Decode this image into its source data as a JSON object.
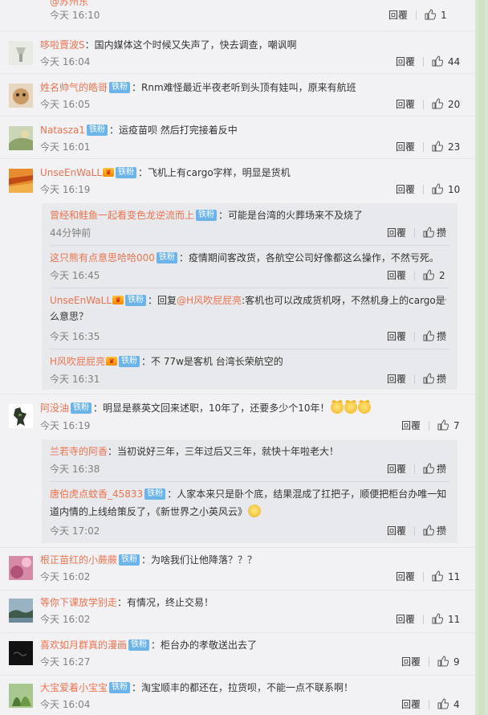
{
  "reply_label": "回覆",
  "zan_label": "攒",
  "top": {
    "ghost_name": "@苏州东",
    "time": "今天 16:10",
    "likes": "1"
  },
  "comments": [
    {
      "user": "哆啦賣波S",
      "badge": "",
      "vip": false,
      "text": "：国内媒体这个时候又失声了，快去调查，嘲讽啊",
      "time": "今天 16:04",
      "likes": "44",
      "avatar": "#c9cfc4"
    },
    {
      "user": "姓名帅气的皓哥",
      "badge": "铁粉",
      "vip": false,
      "text": "：Rnm难怪最近半夜老听到头顶有娃叫，原来有航班",
      "time": "今天 16:05",
      "likes": "20",
      "avatar": "#b58a5a"
    },
    {
      "user": "Natasza1",
      "badge": "铁粉",
      "vip": false,
      "text": "：运疫苗呗 然后打完接着反中",
      "time": "今天 16:01",
      "likes": "23",
      "avatar": "#8fa27a"
    },
    {
      "user": "UnseEnWaLL",
      "badge": "铁粉",
      "vip": true,
      "text": "：飞机上有cargo字样，明显是货机",
      "time": "今天 16:19",
      "likes": "10",
      "avatar": "#d2762a"
    },
    {
      "user": "阿没油",
      "badge": "铁粉",
      "vip": false,
      "text": "：明显是蔡英文回来述职，10年了，还要多少个10年！",
      "emoji_count": 3,
      "time": "今天 16:19",
      "likes": "7",
      "avatar": "#ffffff"
    },
    {
      "user": "根正苗红的小蕨蕨",
      "badge": "铁粉",
      "vip": false,
      "text": "：为啥我们让他降落？？？",
      "time": "今天 16:02",
      "likes": "11",
      "avatar": "#c86a8c"
    },
    {
      "user": "等你下课放学别走",
      "badge": "",
      "vip": false,
      "text": "：有情况，终止交易！",
      "time": "今天 16:02",
      "likes": "11",
      "avatar": "#5b7d91"
    },
    {
      "user": "喜欢如月群真的漫画",
      "badge": "铁粉",
      "vip": false,
      "text": "：柜台办的孝敬送出去了",
      "time": "今天 16:27",
      "likes": "9",
      "avatar": "#1a1a1a"
    },
    {
      "user": "大宝爱着小宝宝",
      "badge": "铁粉",
      "vip": false,
      "text": "：淘宝顺丰的都还在，拉货呗，不能一点不联系啊！",
      "time": "今天 16:04",
      "likes": "4",
      "avatar": "#6f9a58"
    }
  ],
  "subs_a": [
    {
      "user": "曾经和鲑鱼一起看变色龙逆流而上",
      "badge": "铁粉",
      "vip": false,
      "text": "：可能是台湾的火葬场来不及烧了",
      "time": "44分钟前",
      "likes": ""
    },
    {
      "user": "这只熊有点意思哈哈000",
      "badge": "铁粉",
      "vip": false,
      "text": "：疫情期间客改货，各航空公司好像都这么操作，不然亏死。",
      "time": "今天 16:45",
      "likes": "2"
    },
    {
      "user": "UnseEnWaLL",
      "badge": "铁粉",
      "vip": true,
      "text_pre": "：回复",
      "mention": "@H风吹屁屁亮",
      "text": ":客机也可以改成货机呀，不然机身上的cargo是什",
      "text2": "么意思？",
      "time": "今天 16:35",
      "likes": ""
    },
    {
      "user": "H风吹屁屁亮",
      "badge": "铁粉",
      "vip": true,
      "text": "：不 77w是客机 台湾长荣航空的",
      "time": "今天 16:31",
      "likes": ""
    }
  ],
  "subs_b": [
    {
      "user": "兰若寺的阿香",
      "badge": "",
      "vip": false,
      "text": "：当初说好三年，三年过后又三年，就快十年啦老大！",
      "time": "今天 16:38",
      "likes": ""
    },
    {
      "user": "唐伯虎点蚊香_45833",
      "badge": "铁粉",
      "vip": false,
      "text": "：人家本来只是卧个底，结果混成了扛把子，顺便把柜台办唯一知",
      "text2": "道内情的上线给策反了，《新世界之小英风云》",
      "time": "今天 17:02",
      "likes": ""
    }
  ]
}
